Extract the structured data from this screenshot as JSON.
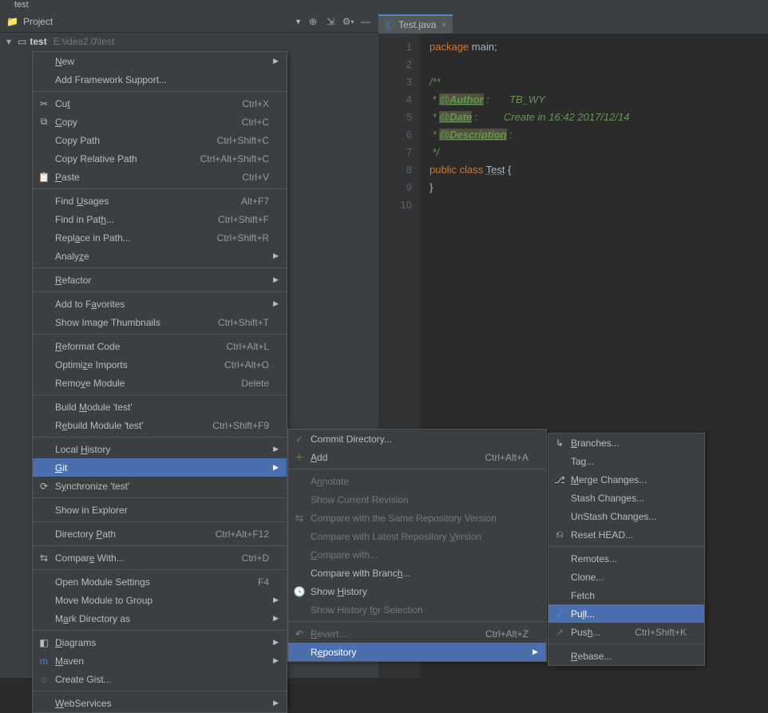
{
  "title": "test",
  "project": {
    "header_label": "Project",
    "root": "test",
    "root_path": "E:\\idea2.0\\test"
  },
  "tab": {
    "icon": "class",
    "label": "Test.java"
  },
  "code": {
    "lines": [
      {
        "html": "<span class='kw'>package</span> <span class='str'>main</span><span class='str'>;</span>"
      },
      {
        "html": ""
      },
      {
        "html": "<span class='com'>/**</span>"
      },
      {
        "html": "<span class='com'> * <span class='tag'>@Author</span> :&nbsp;&nbsp;&nbsp;&nbsp;&nbsp;&nbsp;&nbsp;TB_WY</span>"
      },
      {
        "html": "<span class='com'> * <span class='tag'>@Date</span> :&nbsp;&nbsp;&nbsp;&nbsp;&nbsp;&nbsp;&nbsp;&nbsp;&nbsp;Create in 16:42 2017/12/14</span>"
      },
      {
        "html": "<span class='com'> * <span class='tag'>@Description</span> :</span>"
      },
      {
        "html": "<span class='com'> */</span>"
      },
      {
        "html": "<span class='kw'>public class</span> <span class='cls'><span class='cls-name'>Test</span></span> {"
      },
      {
        "html": "}"
      },
      {
        "html": ""
      }
    ]
  },
  "context_menu": [
    {
      "label": "<u>N</u>ew",
      "arrow": true
    },
    {
      "label": "Add Framework Support..."
    },
    {
      "sep": true
    },
    {
      "icon": "✂",
      "label": "Cu<u>t</u>",
      "shortcut": "Ctrl+X"
    },
    {
      "icon": "⧉",
      "label": "<u>C</u>opy",
      "shortcut": "Ctrl+C"
    },
    {
      "label": "Copy Path",
      "shortcut": "Ctrl+Shift+C"
    },
    {
      "label": "Copy Relative Path",
      "shortcut": "Ctrl+Alt+Shift+C"
    },
    {
      "icon": "📋",
      "label": "<u>P</u>aste",
      "shortcut": "Ctrl+V"
    },
    {
      "sep": true
    },
    {
      "label": "Find <u>U</u>sages",
      "shortcut": "Alt+F7"
    },
    {
      "label": "Find in Pat<u>h</u>...",
      "shortcut": "Ctrl+Shift+F"
    },
    {
      "label": "Repl<u>a</u>ce in Path...",
      "shortcut": "Ctrl+Shift+R"
    },
    {
      "label": "Analy<u>z</u>e",
      "arrow": true
    },
    {
      "sep": true
    },
    {
      "label": "<u>R</u>efactor",
      "arrow": true
    },
    {
      "sep": true
    },
    {
      "label": "Add to F<u>a</u>vorites",
      "arrow": true
    },
    {
      "label": "Show Image Thumbnails",
      "shortcut": "Ctrl+Shift+T"
    },
    {
      "sep": true
    },
    {
      "label": "<u>R</u>eformat Code",
      "shortcut": "Ctrl+Alt+L"
    },
    {
      "label": "Optimi<u>z</u>e Imports",
      "shortcut": "Ctrl+Alt+O"
    },
    {
      "label": "Remo<u>v</u>e Module",
      "shortcut": "Delete"
    },
    {
      "sep": true
    },
    {
      "label": "Build <u>M</u>odule 'test'"
    },
    {
      "label": "R<u>e</u>build Module 'test'",
      "shortcut": "Ctrl+Shift+F9"
    },
    {
      "sep": true
    },
    {
      "label": "Local <u>H</u>istory",
      "arrow": true
    },
    {
      "highlight": true,
      "label": "<u>G</u>it",
      "arrow": true
    },
    {
      "icon": "⟳",
      "label": "S<u>y</u>nchronize 'test'"
    },
    {
      "sep": true
    },
    {
      "label": "Show in Explorer"
    },
    {
      "sep": true
    },
    {
      "label": "Directory <u>P</u>ath",
      "shortcut": "Ctrl+Alt+F12"
    },
    {
      "sep": true
    },
    {
      "icon": "⇆",
      "label": "Compar<u>e</u> With...",
      "shortcut": "Ctrl+D"
    },
    {
      "sep": true
    },
    {
      "label": "Open Module Settings",
      "shortcut": "F4"
    },
    {
      "label": "Move Module to Group",
      "arrow": true
    },
    {
      "label": "M<u>a</u>rk Directory as",
      "arrow": true
    },
    {
      "sep": true
    },
    {
      "icon": "◧",
      "label": "<u>D</u>iagrams",
      "arrow": true
    },
    {
      "icon": "m",
      "iconcolor": "#4a88c7",
      "label": "<u>M</u>aven",
      "arrow": true
    },
    {
      "icon": "◌",
      "label": "Create Gist..."
    },
    {
      "sep": true
    },
    {
      "label": "<u>W</u>ebServices",
      "arrow": true
    }
  ],
  "git_submenu": [
    {
      "icon": "✓",
      "iconcolor": "#6a8759",
      "label": "Commit Directory..."
    },
    {
      "icon": "＋",
      "iconcolor": "#6a8759",
      "label": "<u>A</u>dd",
      "shortcut": "Ctrl+Alt+A"
    },
    {
      "sep": true
    },
    {
      "disabled": true,
      "label": "A<u>n</u>notate"
    },
    {
      "disabled": true,
      "label": "Show Current Revision"
    },
    {
      "icon": "⇆",
      "disabled": true,
      "label": "Compare with the Same Repository Version"
    },
    {
      "disabled": true,
      "label": "Compare with Latest Repository <u>V</u>ersion"
    },
    {
      "disabled": true,
      "label": "<u>C</u>ompare with..."
    },
    {
      "label": "Compare with Branc<u>h</u>..."
    },
    {
      "icon": "🕓",
      "label": "Show <u>H</u>istory"
    },
    {
      "disabled": true,
      "label": "Show History f<u>o</u>r Selection"
    },
    {
      "sep": true
    },
    {
      "icon": "↶",
      "iconcolor": "#888",
      "disabled": true,
      "label": "<u>R</u>evert...",
      "shortcut": "Ctrl+Alt+Z"
    },
    {
      "highlight": true,
      "label": "R<u>e</u>pository",
      "arrow": true
    }
  ],
  "repo_submenu": [
    {
      "icon": "↳",
      "label": "<u>B</u>ranches..."
    },
    {
      "label": "Tag..."
    },
    {
      "icon": "⎇",
      "label": "<u>M</u>erge Changes..."
    },
    {
      "label": "Stash Changes..."
    },
    {
      "label": "UnStash Changes..."
    },
    {
      "icon": "⎌",
      "label": "Reset HEAD..."
    },
    {
      "sep": true
    },
    {
      "label": "Remotes..."
    },
    {
      "label": "Clone..."
    },
    {
      "label": "Fetch"
    },
    {
      "icon": "↙",
      "iconcolor": "#4a88c7",
      "highlight": true,
      "label": "Pu<u>l</u>l..."
    },
    {
      "icon": "↗",
      "iconcolor": "#6a8759",
      "label": "Pus<u>h</u>...",
      "shortcut": "Ctrl+Shift+K"
    },
    {
      "sep": true
    },
    {
      "label": "<u>R</u>ebase..."
    }
  ]
}
